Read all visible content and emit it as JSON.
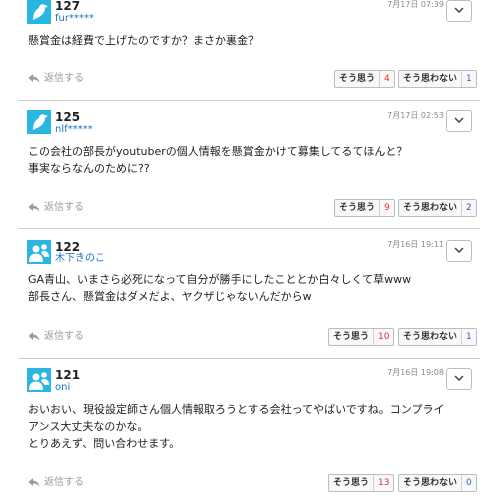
{
  "comments": [
    {
      "number": "127",
      "user": "fur*****",
      "date": "7月17日 07:39",
      "lines": [
        "懸賞金は経費で上げたのですか？まさか裏金？"
      ],
      "reply_label": "返信する",
      "agree_label": "そう思う",
      "agree_count": "4",
      "disagree_label": "そう思わない",
      "disagree_count": "1",
      "avatar_icon": "bird-silhouette-icon"
    },
    {
      "number": "125",
      "user": "nlf*****",
      "date": "7月17日 02:53",
      "lines": [
        "この会社の部長がyoutuberの個人情報を懸賞金かけて募集してるてほんと？",
        "事実ならなんのために??"
      ],
      "reply_label": "返信する",
      "agree_label": "そう思う",
      "agree_count": "9",
      "disagree_label": "そう思わない",
      "disagree_count": "2",
      "avatar_icon": "bird-silhouette-icon"
    },
    {
      "number": "122",
      "user": "木下きのこ",
      "date": "7月16日 19:11",
      "lines": [
        "GA青山、いまさら必死になって自分が勝手にしたこととか白々しくて草www",
        "部長さん、懸賞金はダメだよ、ヤクザじゃないんだからw"
      ],
      "reply_label": "返信する",
      "agree_label": "そう思う",
      "agree_count": "10",
      "disagree_label": "そう思わない",
      "disagree_count": "1",
      "avatar_icon": "people-silhouette-icon"
    },
    {
      "number": "121",
      "user": "oni",
      "date": "7月16日 19:08",
      "lines": [
        "おいおい、現役設定師さん個人情報取ろうとする会社ってやばいですね。コンプライ",
        "アンス大丈夫なのかな。",
        "とりあえず、問い合わせます。"
      ],
      "reply_label": "返信する",
      "agree_label": "そう思う",
      "agree_count": "13",
      "disagree_label": "そう思わない",
      "disagree_count": "0",
      "avatar_icon": "people-silhouette-icon"
    }
  ],
  "colors": {
    "avatar_bg": "#29b6e0",
    "username": "#1a73c8",
    "agree_count": "#d33333",
    "disagree_count": "#2a62c8"
  }
}
